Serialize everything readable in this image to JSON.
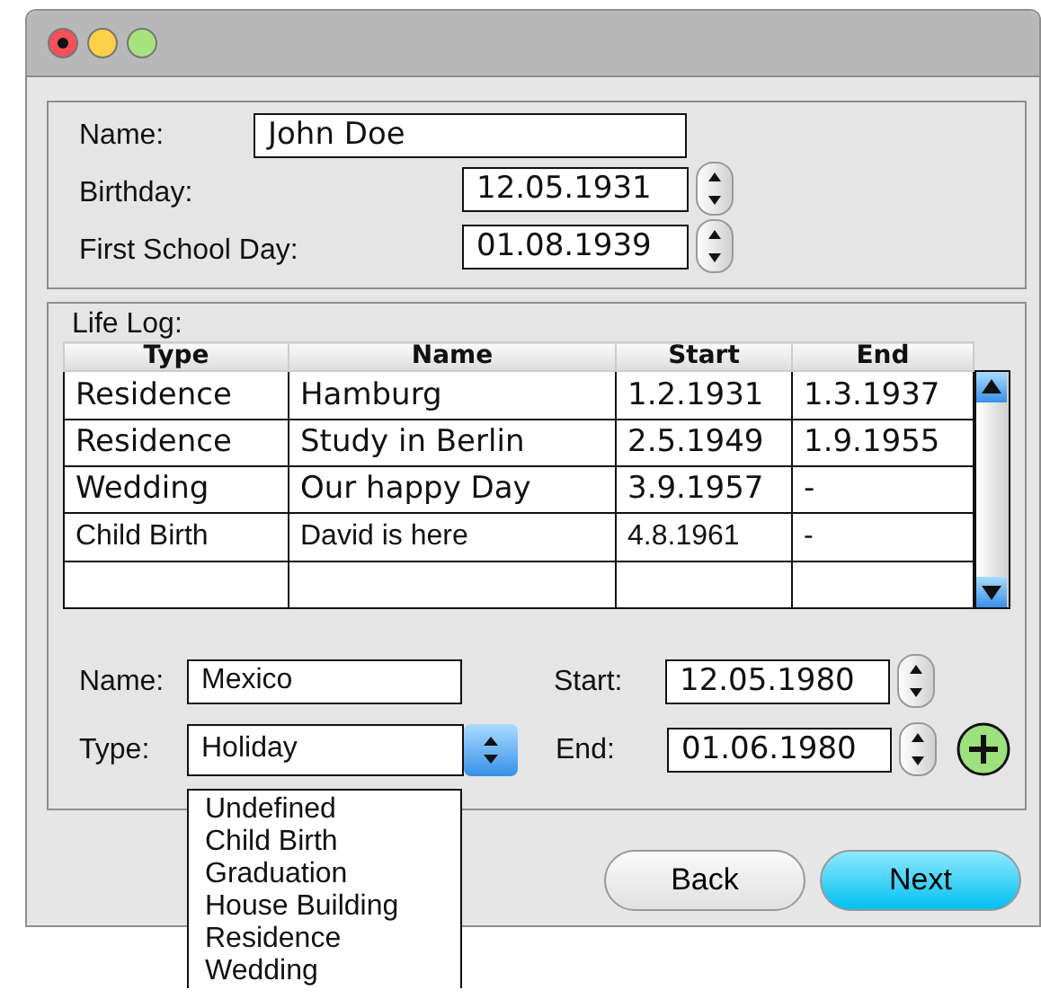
{
  "person": {
    "name_label": "Name:",
    "name": "John Doe",
    "birthday_label": "Birthday:",
    "birthday": "12.05.1931",
    "school_label": "First School Day:",
    "school_day": "01.08.1939"
  },
  "life_log": {
    "title": "Life Log:",
    "columns": [
      "Type",
      "Name",
      "Start",
      "End"
    ],
    "rows": [
      [
        "Residence",
        "Hamburg",
        "1.2.1931",
        "1.3.1937"
      ],
      [
        "Residence",
        "Study in Berlin",
        "2.5.1949",
        "1.9.1955"
      ],
      [
        "Wedding",
        "Our happy Day",
        "3.9.1957",
        "-"
      ],
      [
        "Child Birth",
        "David is here",
        "4.8.1961",
        "-"
      ]
    ]
  },
  "entry": {
    "name_label": "Name:",
    "name": "Mexico",
    "type_label": "Type:",
    "type": "Holiday",
    "type_expanded": true,
    "type_options": [
      "Undefined",
      "Child Birth",
      "Graduation",
      "House Building",
      "Residence",
      "Wedding"
    ],
    "start_label": "Start:",
    "start": "12.05.1980",
    "end_label": "End:",
    "end": "01.06.1980"
  },
  "buttons": [
    {
      "label": "Back",
      "default": false
    },
    {
      "label": "Next",
      "default": true
    }
  ]
}
